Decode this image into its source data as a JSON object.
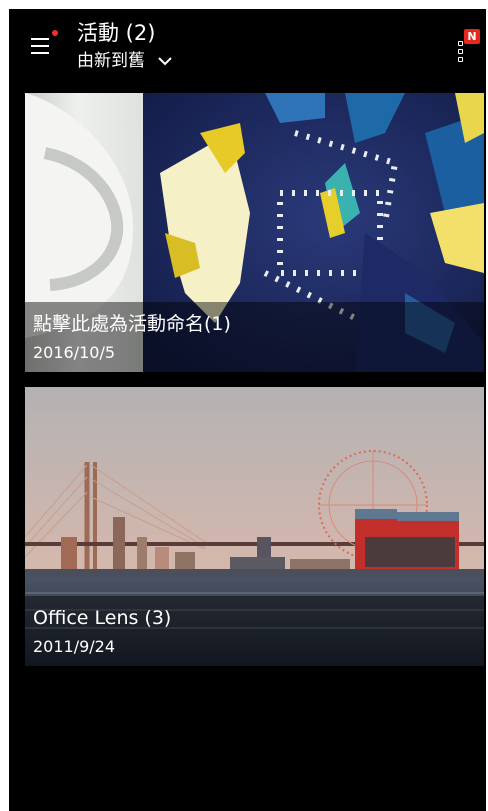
{
  "header": {
    "title": "活動 (2)",
    "sort_label": "由新到舊",
    "badge": "N"
  },
  "albums": [
    {
      "name": "點擊此處為活動命名(1)",
      "date": "2016/10/5"
    },
    {
      "name": "Office Lens (3)",
      "date": "2011/9/24"
    }
  ],
  "colors": {
    "background": "#000000",
    "badge": "#e8261e",
    "notification_dot": "#ff2a2a"
  },
  "icons": [
    "menu-icon",
    "chevron-down-icon",
    "overflow-menu-icon"
  ]
}
